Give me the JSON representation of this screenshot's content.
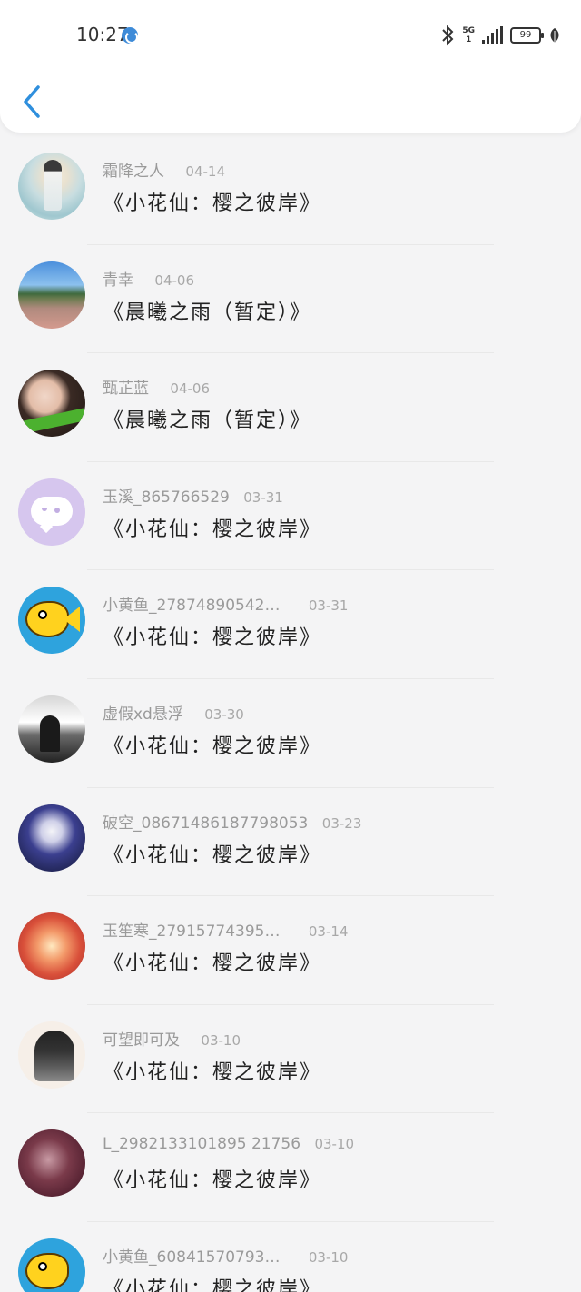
{
  "status_bar": {
    "time": "10:27",
    "network_top": "5G",
    "network_bottom": "1",
    "battery_level": "99"
  },
  "list": [
    {
      "username": "霜降之人",
      "date": "04-14",
      "title": "《小花仙：樱之彼岸》"
    },
    {
      "username": "青幸",
      "date": "04-06",
      "title": "《晨曦之雨（暂定）》"
    },
    {
      "username": "甄芷蓝",
      "date": "04-06",
      "title": "《晨曦之雨（暂定）》"
    },
    {
      "username": "玉溪_865766529",
      "date": "03-31",
      "title": "《小花仙：樱之彼岸》"
    },
    {
      "username": "小黄鱼_27874890542…",
      "date": "03-31",
      "title": "《小花仙：樱之彼岸》"
    },
    {
      "username": "虚假xd悬浮",
      "date": "03-30",
      "title": "《小花仙：樱之彼岸》"
    },
    {
      "username": "破空_08671486187798053",
      "date": "03-23",
      "title": "《小花仙：樱之彼岸》"
    },
    {
      "username": "玉笙寒_27915774395…",
      "date": "03-14",
      "title": "《小花仙：樱之彼岸》"
    },
    {
      "username": "可望即可及",
      "date": "03-10",
      "title": "《小花仙：樱之彼岸》"
    },
    {
      "username": "L_2982133101895 21756",
      "date": "03-10",
      "title": "《小花仙：樱之彼岸》"
    },
    {
      "username": "小黄鱼_60841570793…",
      "date": "03-10",
      "title": "《小花仙：樱之彼岸》"
    }
  ],
  "colors": {
    "accent": "#2f8fdd",
    "background": "#f4f4f5",
    "meta_text": "#9a9a9a",
    "title_text": "#222222"
  }
}
